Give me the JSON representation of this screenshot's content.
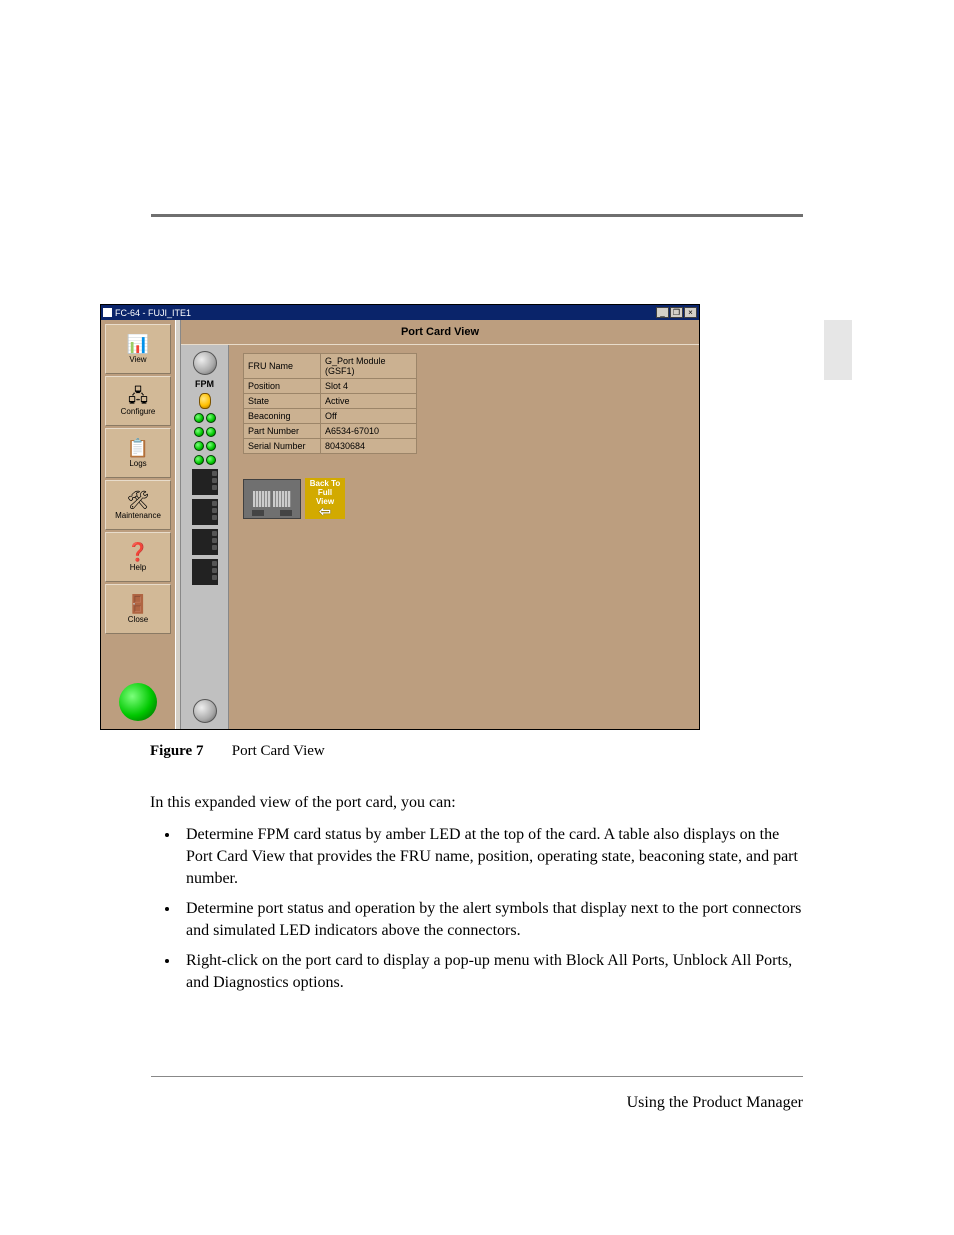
{
  "window": {
    "title": "FC-64  - FUJI_ITE1",
    "main_title": "Port Card View"
  },
  "sidebar": {
    "items": [
      {
        "label": "View",
        "icon": "📊"
      },
      {
        "label": "Configure",
        "icon": "🖧"
      },
      {
        "label": "Logs",
        "icon": "📋"
      },
      {
        "label": "Maintenance",
        "icon": "🛠"
      },
      {
        "label": "Help",
        "icon": "❓"
      },
      {
        "label": "Close",
        "icon": "🚪"
      }
    ]
  },
  "fpm": {
    "label": "FPM"
  },
  "detail_rows": [
    {
      "k": "FRU Name",
      "v": "G_Port Module (GSF1)"
    },
    {
      "k": "Position",
      "v": "Slot 4"
    },
    {
      "k": "State",
      "v": "Active"
    },
    {
      "k": "Beaconing",
      "v": "Off"
    },
    {
      "k": "Part Number",
      "v": "A6534-67010"
    },
    {
      "k": "Serial Number",
      "v": "80430684"
    }
  ],
  "back_button": {
    "line1": "Back To",
    "line2": "Full",
    "line3": "View"
  },
  "caption": {
    "label": "Figure 7",
    "text": "Port Card View"
  },
  "body": {
    "lead": "In this expanded view of the port card, you can:",
    "bullets": [
      "Determine FPM card status by amber LED at the top of the card. A table also displays on the Port Card View that provides the FRU name, position, operating state, beaconing state, and part number.",
      "Determine port status and operation by the alert symbols that display next to the port connectors and simulated LED indicators above the connectors.",
      "Right-click on the port card to display a pop-up menu with Block All Ports, Unblock All Ports, and Diagnostics options."
    ]
  },
  "footer": "Using the Product Manager"
}
